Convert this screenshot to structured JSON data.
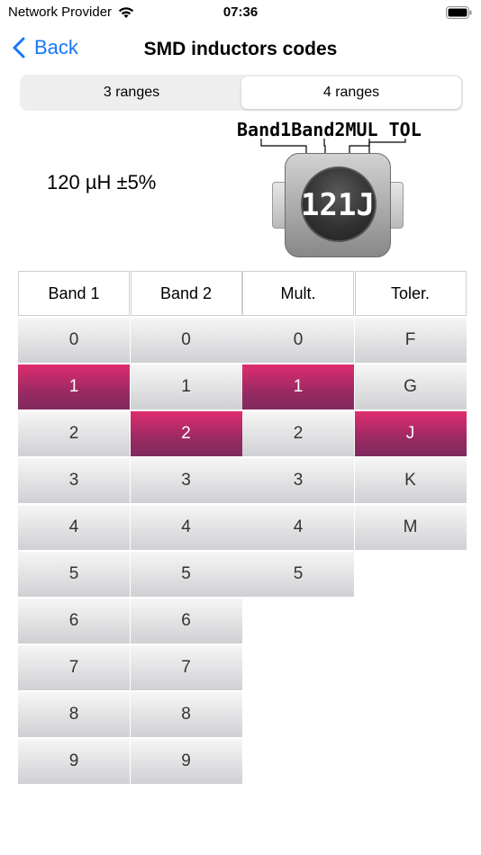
{
  "status_bar": {
    "carrier": "Network Provider",
    "time": "07:36",
    "wifi_icon": "wifi-icon",
    "battery_icon": "battery-icon"
  },
  "nav": {
    "back_label": "Back",
    "back_icon": "chevron-left-icon",
    "title": "SMD inductors codes"
  },
  "segmented": {
    "options": [
      "3 ranges",
      "4 ranges"
    ],
    "selected": "4 ranges"
  },
  "result": "120 µH ±5%",
  "diagram": {
    "band_labels": [
      "Band1",
      "Band2",
      "MUL",
      "TOL"
    ],
    "code": "121J"
  },
  "table": {
    "headers": [
      "Band 1",
      "Band 2",
      "Mult.",
      "Toler."
    ],
    "columns": [
      [
        "0",
        "1",
        "2",
        "3",
        "4",
        "5",
        "6",
        "7",
        "8",
        "9"
      ],
      [
        "0",
        "1",
        "2",
        "3",
        "4",
        "5",
        "6",
        "7",
        "8",
        "9"
      ],
      [
        "0",
        "1",
        "2",
        "3",
        "4",
        "5"
      ],
      [
        "F",
        "G",
        "J",
        "K",
        "M"
      ]
    ],
    "selected": [
      "1",
      "2",
      "1",
      "J"
    ]
  },
  "colors": {
    "accent": "#1477f8",
    "selected_top": "#e02c6f",
    "selected_bottom": "#7f2a5e"
  }
}
